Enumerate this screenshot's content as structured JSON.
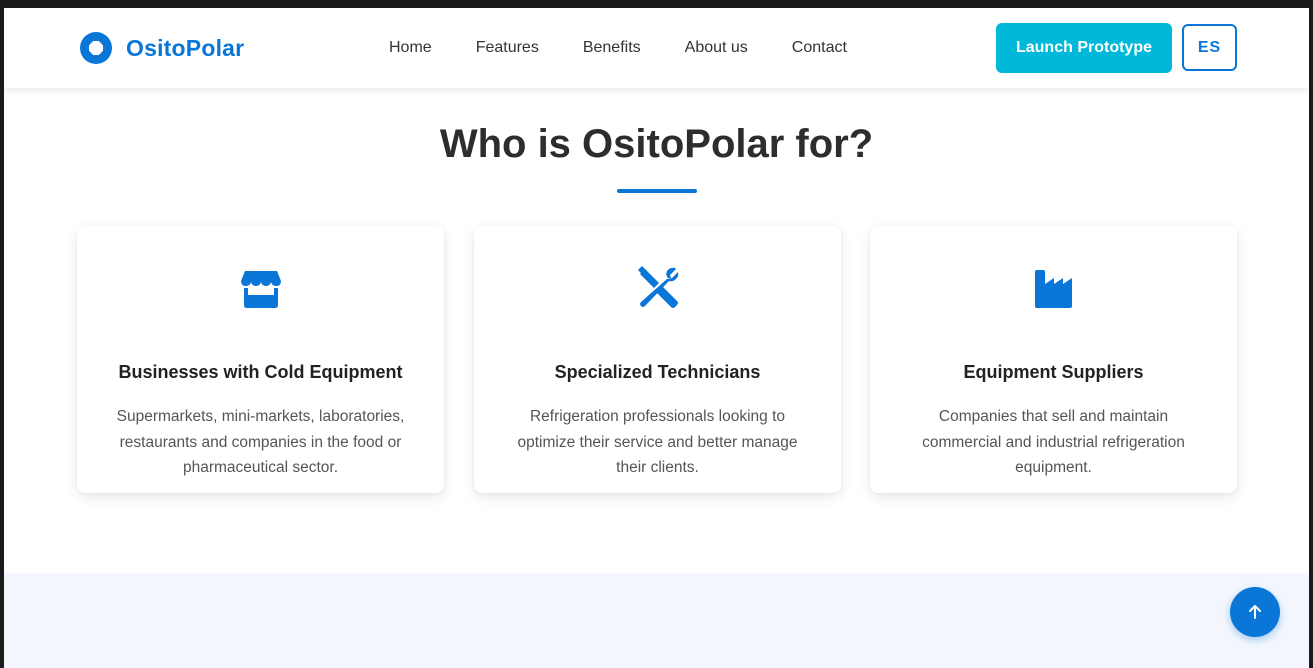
{
  "brand": {
    "name": "OsitoPolar",
    "accent_color": "#0a76d8"
  },
  "nav": {
    "items": [
      {
        "label": "Home"
      },
      {
        "label": "Features"
      },
      {
        "label": "Benefits"
      },
      {
        "label": "About us"
      },
      {
        "label": "Contact"
      }
    ]
  },
  "header_actions": {
    "launch_label": "Launch Prototype",
    "launch_color": "#00b8d9",
    "language_label": "ES"
  },
  "section": {
    "title": "Who is OsitoPolar for?",
    "cards": [
      {
        "icon": "store-icon",
        "title": "Businesses with Cold Equipment",
        "description": "Supermarkets, mini-markets, laboratories, restaurants and companies in the food or pharmaceutical sector."
      },
      {
        "icon": "tools-icon",
        "title": "Specialized Technicians",
        "description": "Refrigeration professionals looking to optimize their service and better manage their clients."
      },
      {
        "icon": "industry-icon",
        "title": "Equipment Suppliers",
        "description": "Companies that sell and maintain commercial and industrial refrigeration equipment."
      }
    ]
  },
  "scroll_top": {
    "icon": "arrow-up-icon"
  }
}
